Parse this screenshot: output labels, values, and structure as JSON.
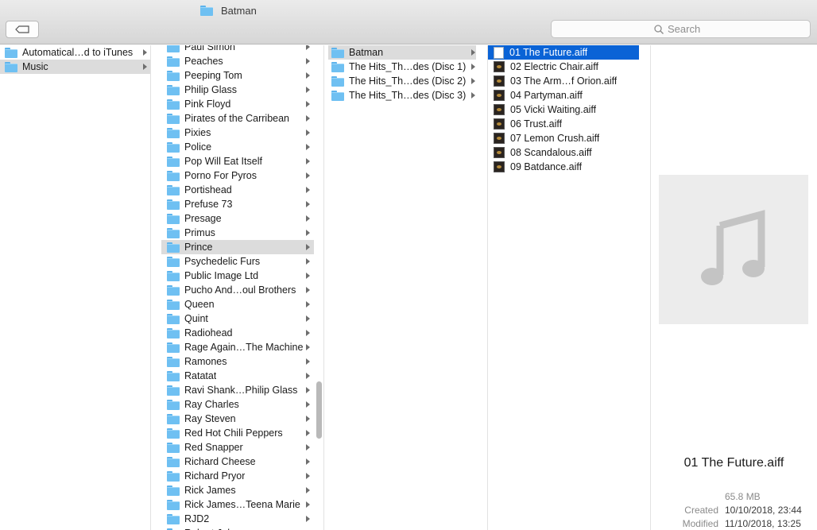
{
  "window": {
    "title": "Batman"
  },
  "search": {
    "placeholder": "Search"
  },
  "column1": {
    "items": [
      {
        "label": "Automatical…d to iTunes",
        "selected": false
      },
      {
        "label": "Music",
        "selected": true
      }
    ]
  },
  "column2": {
    "items": [
      {
        "label": "Paul Simon"
      },
      {
        "label": "Peaches"
      },
      {
        "label": "Peeping Tom"
      },
      {
        "label": "Philip Glass"
      },
      {
        "label": "Pink Floyd"
      },
      {
        "label": "Pirates of the Carribean"
      },
      {
        "label": "Pixies"
      },
      {
        "label": "Police"
      },
      {
        "label": "Pop Will Eat Itself"
      },
      {
        "label": "Porno For Pyros"
      },
      {
        "label": "Portishead"
      },
      {
        "label": "Prefuse 73"
      },
      {
        "label": "Presage"
      },
      {
        "label": "Primus"
      },
      {
        "label": "Prince",
        "selected": true
      },
      {
        "label": "Psychedelic Furs"
      },
      {
        "label": "Public Image Ltd"
      },
      {
        "label": "Pucho And…oul Brothers"
      },
      {
        "label": "Queen"
      },
      {
        "label": "Quint"
      },
      {
        "label": "Radiohead"
      },
      {
        "label": "Rage Again…The Machine"
      },
      {
        "label": "Ramones"
      },
      {
        "label": "Ratatat"
      },
      {
        "label": "Ravi Shank…Philip Glass"
      },
      {
        "label": "Ray Charles"
      },
      {
        "label": "Ray Steven"
      },
      {
        "label": "Red Hot Chili Peppers"
      },
      {
        "label": "Red Snapper"
      },
      {
        "label": "Richard Cheese"
      },
      {
        "label": "Richard Pryor"
      },
      {
        "label": "Rick James"
      },
      {
        "label": "Rick James…Teena Marie"
      },
      {
        "label": "RJD2"
      },
      {
        "label": "Robert Johnson"
      }
    ]
  },
  "column3": {
    "items": [
      {
        "label": "Batman",
        "selected": true
      },
      {
        "label": "The Hits_Th…des (Disc 1)"
      },
      {
        "label": "The Hits_Th…des (Disc 2)"
      },
      {
        "label": "The Hits_Th…des (Disc 3)"
      }
    ]
  },
  "column4": {
    "items": [
      {
        "label": "01 The Future.aiff",
        "selected": true
      },
      {
        "label": "02 Electric Chair.aiff"
      },
      {
        "label": "03 The Arm…f Orion.aiff"
      },
      {
        "label": "04 Partyman.aiff"
      },
      {
        "label": "05 Vicki Waiting.aiff"
      },
      {
        "label": "06 Trust.aiff"
      },
      {
        "label": "07 Lemon Crush.aiff"
      },
      {
        "label": "08 Scandalous.aiff"
      },
      {
        "label": "09 Batdance.aiff"
      }
    ]
  },
  "preview": {
    "file_name": "01 The Future.aiff",
    "size": "65.8 MB",
    "created_label": "Created",
    "created_value": "10/10/2018, 23:44",
    "modified_label": "Modified",
    "modified_value": "11/10/2018, 13:25"
  },
  "colors": {
    "selection_blue": "#0a63d6",
    "selection_grey": "#dcdcdc",
    "folder_blue": "#6fc0f2"
  },
  "icons": {
    "back": "back-arrow-icon",
    "search": "magnifier-icon",
    "folder": "folder-icon",
    "audio": "aiff-file-icon",
    "music": "music-note-icon"
  }
}
